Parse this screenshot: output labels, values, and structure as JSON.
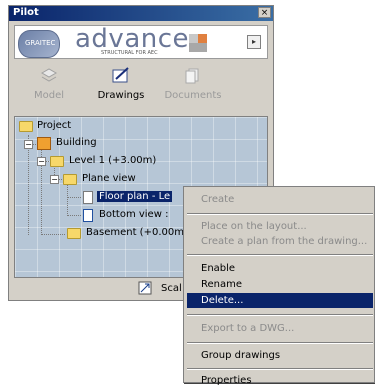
{
  "window": {
    "title": "Pilot",
    "close_glyph": "×"
  },
  "banner": {
    "logo_word": "advance",
    "logo_subtitle": "STRUCTURAL FOR AEC",
    "badge_text": "GRAITEC",
    "expand_glyph": "▸"
  },
  "tabs": [
    {
      "label": "Model",
      "icon": "model-icon",
      "enabled": false
    },
    {
      "label": "Drawings",
      "icon": "drawings-icon",
      "enabled": true
    },
    {
      "label": "Documents",
      "icon": "documents-icon",
      "enabled": false
    }
  ],
  "tree": {
    "project": "Project",
    "building": "Building",
    "level1": "Level 1 (+3.00m)",
    "plane_view": "Plane view",
    "floor_plan": "Floor plan - Le",
    "bottom_view": "Bottom view :",
    "basement": "Basement (+0.00m)"
  },
  "bottom": {
    "scale_label": "Scal"
  },
  "context_menu": {
    "create": "Create",
    "place_on_layout": "Place on the layout...",
    "create_plan": "Create a plan from the drawing...",
    "enable": "Enable",
    "rename": "Rename",
    "delete": "Delete...",
    "export_dwg": "Export to a DWG...",
    "group_drawings": "Group drawings",
    "properties": "Properties"
  },
  "colors": {
    "selection": "#0a246a",
    "tree_bg": "#b6c6d6",
    "window_bg": "#d4d0c8"
  }
}
